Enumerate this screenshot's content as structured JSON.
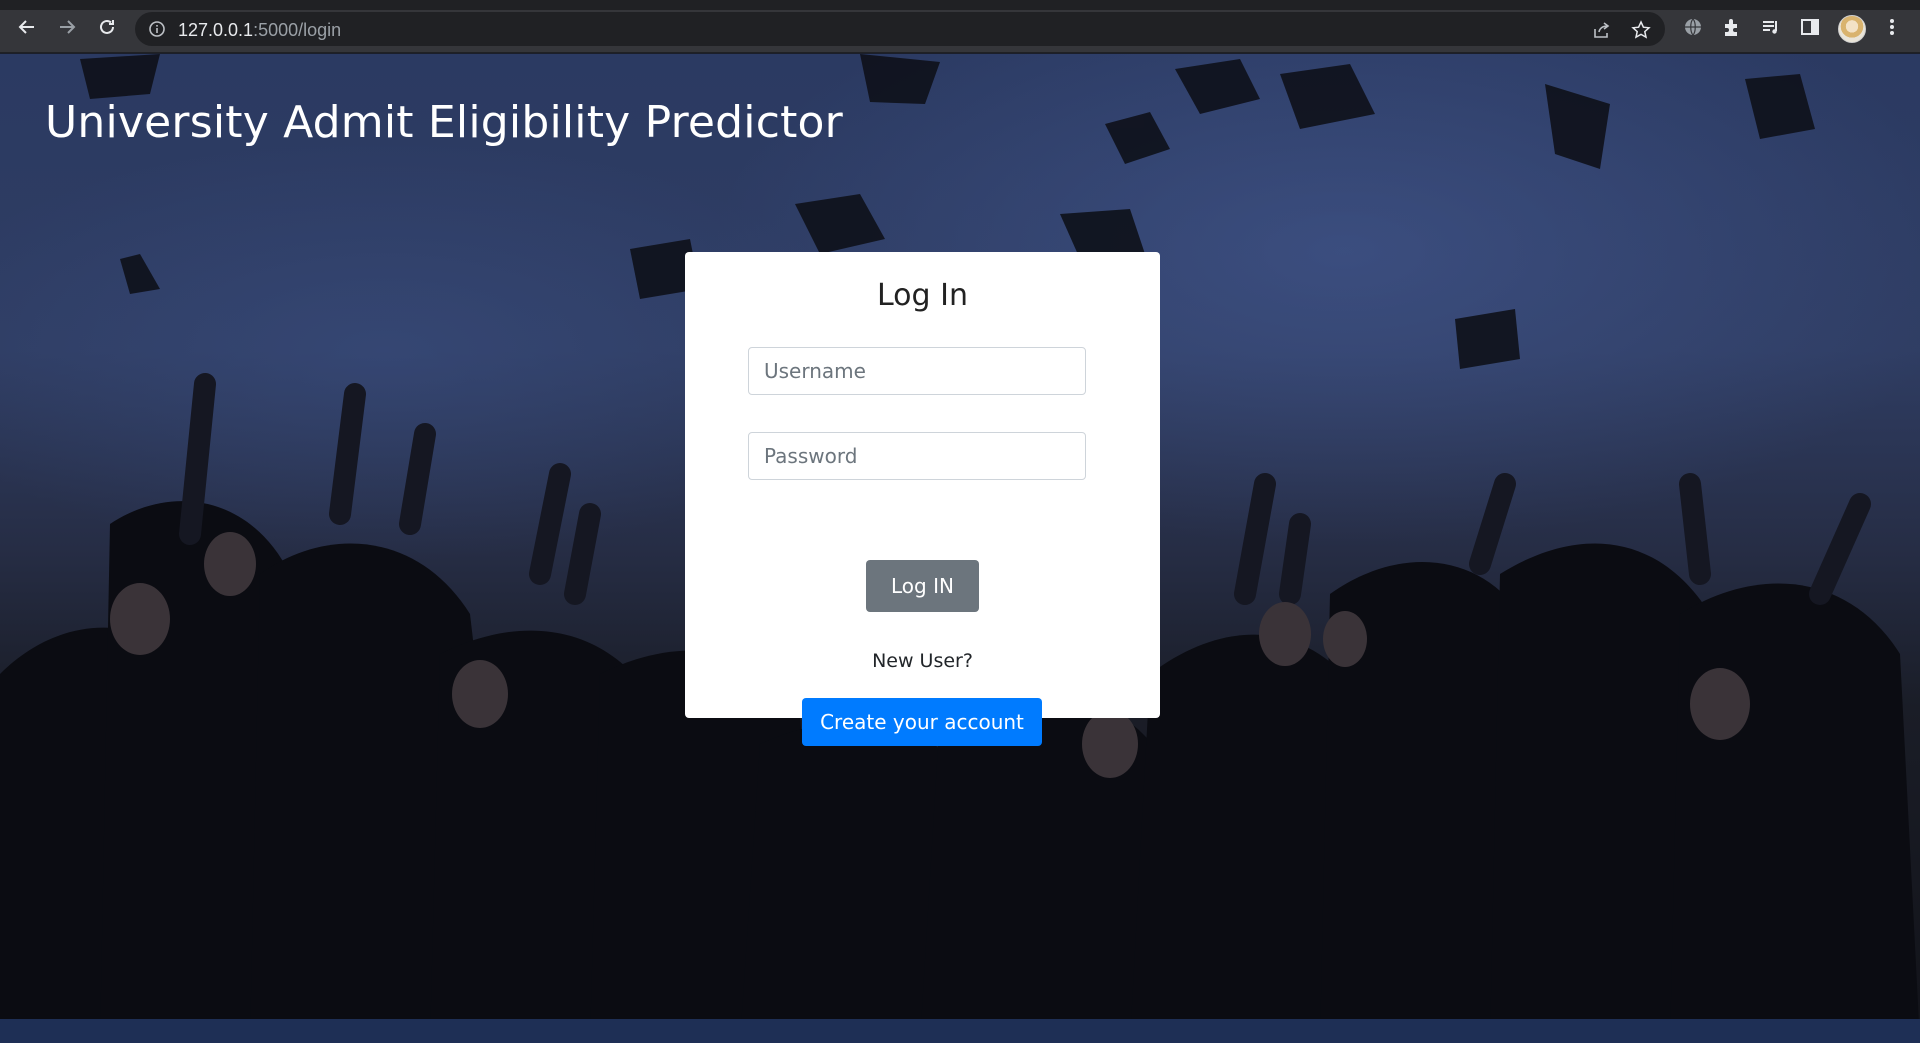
{
  "browser": {
    "url_host": "127.0.0.1",
    "url_rest": ":5000/login",
    "icons": [
      "back-icon",
      "forward-icon",
      "reload-icon",
      "site-info-icon",
      "share-icon",
      "bookmark-star-icon",
      "translate-icon",
      "extensions-icon",
      "media-queue-icon",
      "side-panel-icon",
      "profile-avatar",
      "menu-kebab-icon"
    ]
  },
  "header": {
    "title": "University Admit Eligibility Predictor"
  },
  "login": {
    "heading": "Log In",
    "username_placeholder": "Username",
    "password_placeholder": "Password",
    "submit_label": "Log IN",
    "new_user_text": "New User?",
    "create_account_label": "Create your account"
  },
  "colors": {
    "submit_button": "#6c757d",
    "create_button": "#007bff",
    "card_background": "#ffffff"
  }
}
